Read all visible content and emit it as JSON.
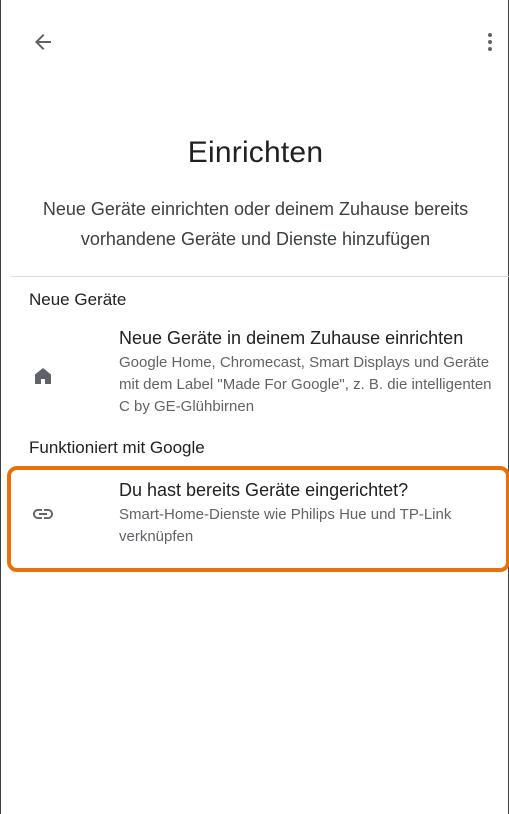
{
  "header": {
    "back_icon": "arrow-back-icon",
    "menu_icon": "more-vert-icon"
  },
  "page": {
    "title": "Einrichten",
    "subtitle": "Neue Geräte einrichten oder deinem Zuhause bereits vorhandene Geräte und Dienste hinzufügen"
  },
  "sections": [
    {
      "header": "Neue Geräte",
      "item": {
        "icon": "home-icon",
        "title": "Neue Geräte in deinem Zuhause einrichten",
        "description": "Google Home, Chromecast, Smart Displays und Geräte mit dem Label \"Made For Google\", z. B. die intelligenten C by GE-Glühbirnen"
      }
    },
    {
      "header": "Funktioniert mit Google",
      "item": {
        "icon": "link-icon",
        "title": "Du hast bereits Geräte eingerichtet?",
        "description": "Smart-Home-Dienste wie Philips Hue und TP-Link verknüpfen",
        "highlighted": true,
        "highlight_color": "#e8710a"
      }
    }
  ],
  "colors": {
    "text_primary": "#202124",
    "text_secondary": "#5f6368",
    "divider": "#dadce0",
    "highlight": "#e8710a"
  }
}
